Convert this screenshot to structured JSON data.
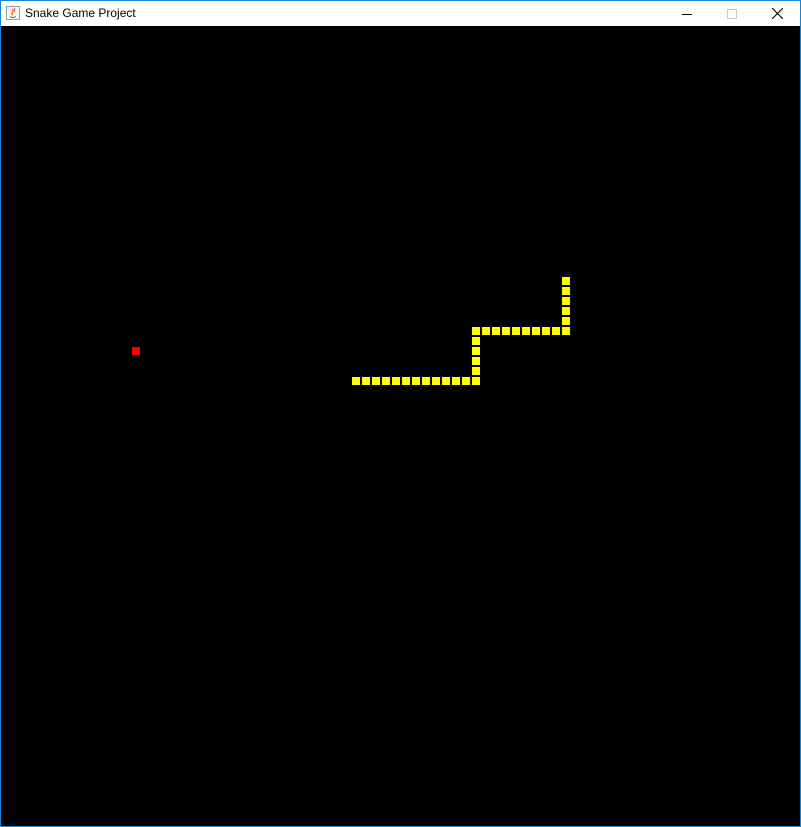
{
  "window": {
    "title": "Snake Game Project",
    "buttons": {
      "minimize": "minimize-icon",
      "maximize": "maximize-icon",
      "close": "close-icon"
    }
  },
  "game": {
    "background": "#000000",
    "cell_unit": "grid cells (10px)",
    "snake_color": "#ffff00",
    "food_color": "#ff0000",
    "food": {
      "col": 13,
      "row": 32
    },
    "snake": [
      {
        "col": 56,
        "row": 25
      },
      {
        "col": 56,
        "row": 26
      },
      {
        "col": 56,
        "row": 27
      },
      {
        "col": 56,
        "row": 28
      },
      {
        "col": 56,
        "row": 29
      },
      {
        "col": 56,
        "row": 30
      },
      {
        "col": 55,
        "row": 30
      },
      {
        "col": 54,
        "row": 30
      },
      {
        "col": 53,
        "row": 30
      },
      {
        "col": 52,
        "row": 30
      },
      {
        "col": 51,
        "row": 30
      },
      {
        "col": 50,
        "row": 30
      },
      {
        "col": 49,
        "row": 30
      },
      {
        "col": 48,
        "row": 30
      },
      {
        "col": 47,
        "row": 30
      },
      {
        "col": 47,
        "row": 31
      },
      {
        "col": 47,
        "row": 32
      },
      {
        "col": 47,
        "row": 33
      },
      {
        "col": 47,
        "row": 34
      },
      {
        "col": 47,
        "row": 35
      },
      {
        "col": 46,
        "row": 35
      },
      {
        "col": 45,
        "row": 35
      },
      {
        "col": 44,
        "row": 35
      },
      {
        "col": 43,
        "row": 35
      },
      {
        "col": 42,
        "row": 35
      },
      {
        "col": 41,
        "row": 35
      },
      {
        "col": 40,
        "row": 35
      },
      {
        "col": 39,
        "row": 35
      },
      {
        "col": 38,
        "row": 35
      },
      {
        "col": 37,
        "row": 35
      },
      {
        "col": 36,
        "row": 35
      },
      {
        "col": 35,
        "row": 35
      }
    ]
  }
}
